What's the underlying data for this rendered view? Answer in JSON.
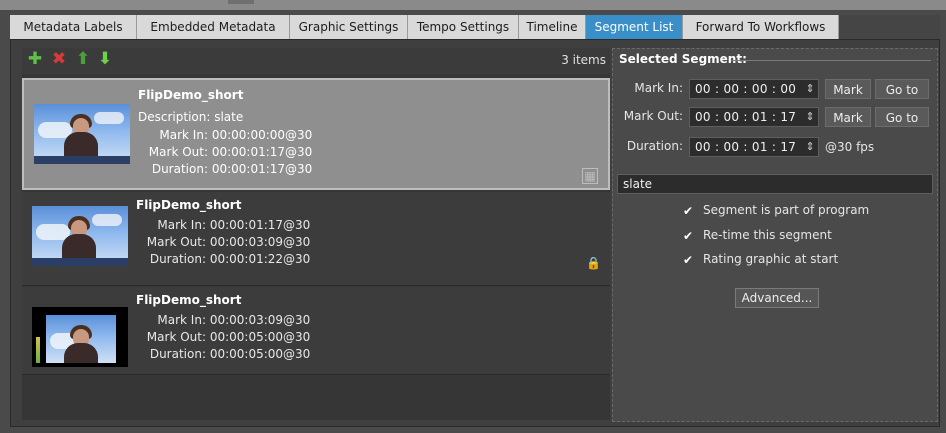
{
  "tabs": [
    {
      "label": "Metadata Labels"
    },
    {
      "label": "Embedded Metadata"
    },
    {
      "label": "Graphic Settings"
    },
    {
      "label": "Tempo Settings"
    },
    {
      "label": "Timeline"
    },
    {
      "label": "Segment List",
      "active": true
    },
    {
      "label": "Forward To Workflows"
    }
  ],
  "toolbar": {
    "icons": [
      "add-icon",
      "delete-icon",
      "move-up-icon",
      "move-down-icon"
    ],
    "items_count": "3 items"
  },
  "segments": [
    {
      "title": "FlipDemo_short",
      "description_label": "Description:",
      "description": "slate",
      "mark_in_label": "Mark In:",
      "mark_in": "00:00:00:00@30",
      "mark_out_label": "Mark Out:",
      "mark_out": "00:00:01:17@30",
      "duration_label": "Duration:",
      "duration": "00:00:01:17@30",
      "icon": "save-icon",
      "selected": true
    },
    {
      "title": "FlipDemo_short",
      "mark_in_label": "Mark In:",
      "mark_in": "00:00:01:17@30",
      "mark_out_label": "Mark Out:",
      "mark_out": "00:00:03:09@30",
      "duration_label": "Duration:",
      "duration": "00:00:01:22@30",
      "icon": "lock-icon"
    },
    {
      "title": "FlipDemo_short",
      "mark_in_label": "Mark In:",
      "mark_in": "00:00:03:09@30",
      "mark_out_label": "Mark Out:",
      "mark_out": "00:00:05:00@30",
      "duration_label": "Duration:",
      "duration": "00:00:05:00@30"
    }
  ],
  "selected_segment": {
    "title": "Selected Segment:",
    "mark_in_label": "Mark In:",
    "mark_in": "00 : 00 : 00 : 00",
    "mark_out_label": "Mark Out:",
    "mark_out": "00 : 00 : 01 : 17",
    "duration_label": "Duration:",
    "duration": "00 : 00 : 01 : 17",
    "fps": "@30 fps",
    "mark_button": "Mark",
    "goto_button": "Go to",
    "description": "slate",
    "checkboxes": [
      {
        "label": "Segment is part of program",
        "checked": true
      },
      {
        "label": "Re-time this segment",
        "checked": true
      },
      {
        "label": "Rating graphic at start",
        "checked": true
      }
    ],
    "advanced_button": "Advanced..."
  },
  "colors": {
    "active_tab": "#3b8fc8",
    "add": "#5cc24a",
    "delete": "#d83a3a",
    "move_up": "#4aa03c",
    "move_down": "#6bd24a"
  }
}
